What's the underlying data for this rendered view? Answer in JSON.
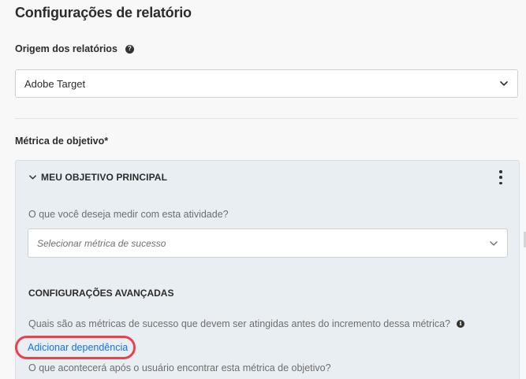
{
  "page": {
    "title": "Configurações de relatório"
  },
  "report_source": {
    "label": "Origem dos relatórios",
    "help_icon": "question-circle-icon",
    "value": "Adobe Target",
    "chevron_icon": "chevron-down-icon"
  },
  "goal_metric": {
    "label": "Métrica de objetivo*",
    "card": {
      "header": "MEU OBJETIVO PRINCIPAL",
      "collapse_icon": "chevron-down-icon",
      "more_icon": "more-vertical-icon",
      "question": "O que você deseja medir com esta atividade?",
      "select_placeholder": "Selecionar métrica de sucesso",
      "advanced_title": "CONFIGURAÇÕES AVANÇADAS",
      "dependency_question": "Quais são as métricas de sucesso que devem ser atingidas antes do incremento dessa métrica?",
      "info_icon": "info-circle-icon",
      "add_dependency": "Adicionar dependência",
      "after_question": "O que acontecerá após o usuário encontrar esta métrica de objetivo?"
    }
  },
  "colors": {
    "link": "#1473e6",
    "highlight": "#e8424d",
    "card_bg": "#e9eef2",
    "page_bg": "#f8f8f8"
  }
}
